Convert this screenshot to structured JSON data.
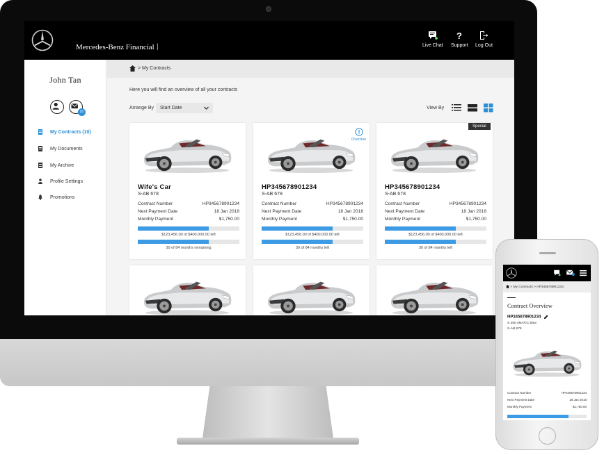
{
  "header": {
    "brand": "Mercedes-Benz Financial",
    "brand_separator": "|",
    "live_chat": "Live Chat",
    "support": "Support",
    "log_out": "Log Out"
  },
  "sidebar": {
    "user_name": "John Tan",
    "message_badge": "20",
    "items": [
      {
        "label": "My Contracts (10)",
        "icon": "document-icon",
        "active": true
      },
      {
        "label": "My Documents",
        "icon": "documents-icon",
        "active": false
      },
      {
        "label": "My Archive",
        "icon": "archive-icon",
        "active": false
      },
      {
        "label": "Profile Settings",
        "icon": "user-icon",
        "active": false
      },
      {
        "label": "Promotions",
        "icon": "bell-icon",
        "active": false
      }
    ]
  },
  "main": {
    "breadcrumb": "> My Contracts",
    "intro": "Here you will find an overview of all your contracts",
    "arrange_label": "Arrange By",
    "arrange_value": "Start Date",
    "view_label": "View By",
    "contract_number_label": "Contract Number",
    "next_payment_label": "Next Payment Date",
    "monthly_payment_label": "Monthly Payment",
    "cards": [
      {
        "title": "Wife's Car",
        "plate": "S-AB 678",
        "contract_number": "HP345678901234",
        "next_payment_date": "18 Jan 2018",
        "monthly_payment": "$1,750.00",
        "amount_caption": "$123,456.00 of $400,000.00 left",
        "months_caption": "30 of 84 months remaining",
        "amount_progress": 0.7,
        "months_progress": 0.7,
        "flag": ""
      },
      {
        "title": "HP345678901234",
        "plate": "S-AB 678",
        "contract_number": "HP345678901234",
        "next_payment_date": "18 Jan 2018",
        "monthly_payment": "$1,750.00",
        "amount_caption": "$123,456.00 of $400,000.00 left",
        "months_caption": "30 of 84 months left",
        "amount_progress": 0.7,
        "months_progress": 0.7,
        "flag": "Overdue"
      },
      {
        "title": "HP345678901234",
        "plate": "S-AB 678",
        "contract_number": "HP345678901234",
        "next_payment_date": "18 Jan 2018",
        "monthly_payment": "$1,750.00",
        "amount_caption": "$123,456.00 of $400,000.00 left",
        "months_caption": "30 of 84 months left",
        "amount_progress": 0.7,
        "months_progress": 0.7,
        "flag": "Special"
      }
    ]
  },
  "phone": {
    "breadcrumb": "> My Contracts > HP345678901234",
    "title": "Contract Overview",
    "contract_number": "HP345678901234",
    "model": "S 350 4MATIC Blue",
    "plate": "S-AB 678",
    "contract_number_label": "Contract Number",
    "contract_number_value": "HP345678901234",
    "next_payment_label": "Next Payment Date",
    "next_payment_value": "18 Jan 2018",
    "monthly_payment_label": "Monthly Payment",
    "monthly_payment_value": "$1,750.00",
    "progress": 0.77
  },
  "colors": {
    "accent": "#2b8fd6",
    "progress": "#3d9be4",
    "header_bg": "#000000"
  }
}
